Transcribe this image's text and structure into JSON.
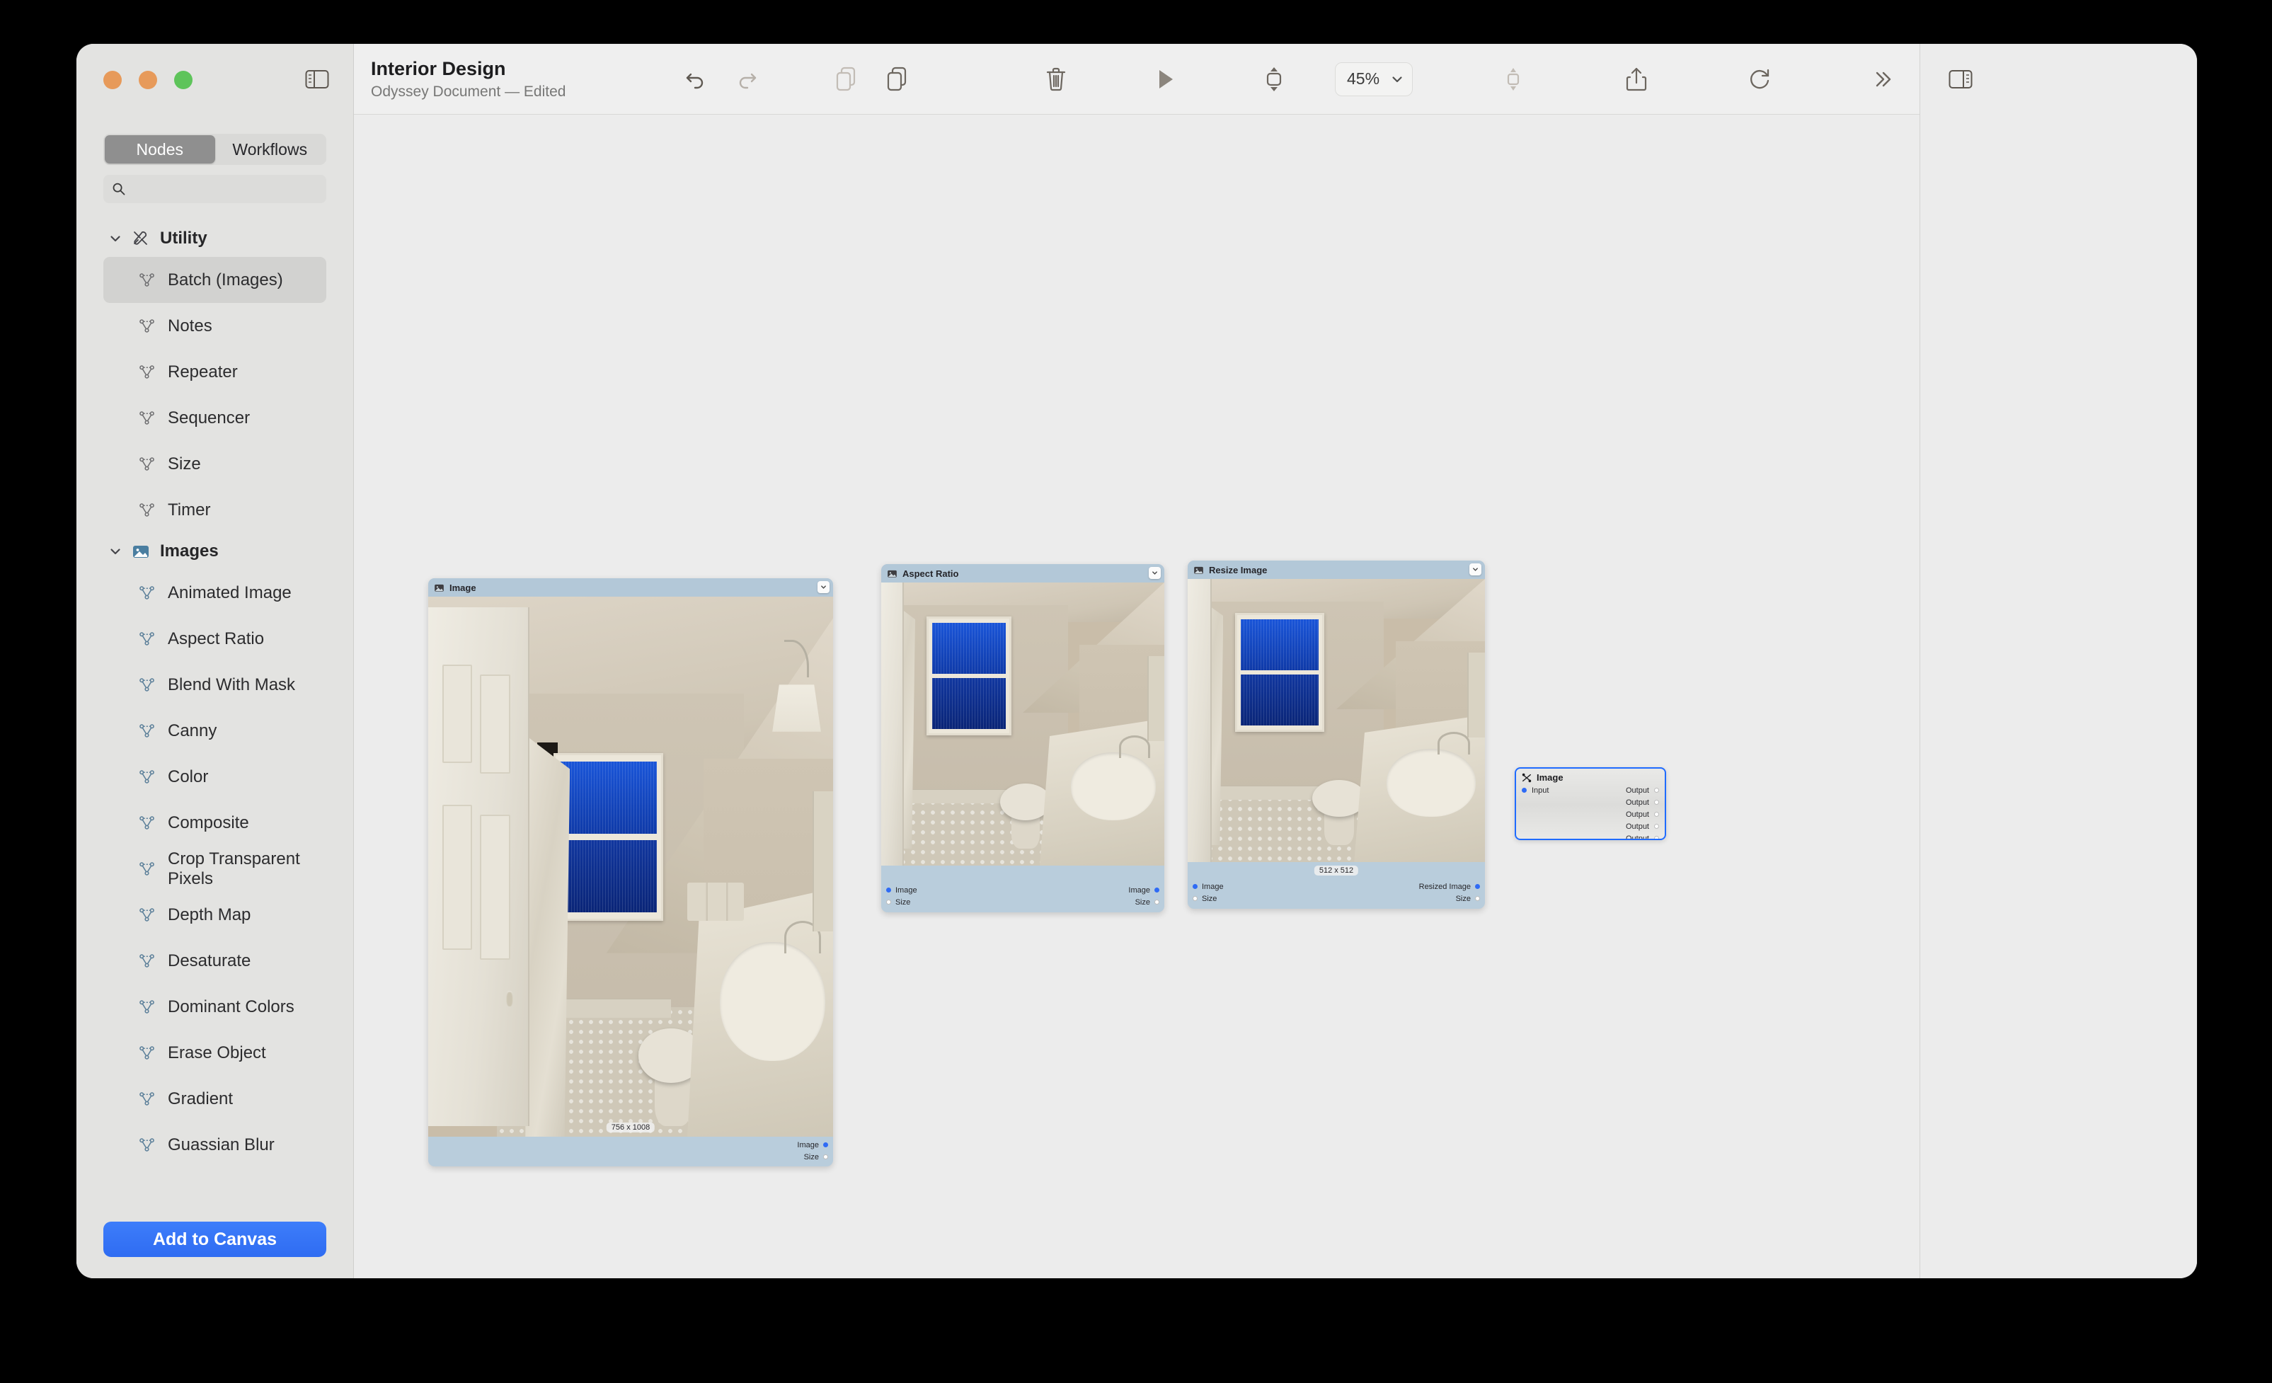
{
  "window": {
    "traffic_lights": [
      "close",
      "minimize",
      "zoom"
    ],
    "sidebar_toggle_icon": "sidebar-left-icon"
  },
  "sidebar": {
    "tabs": [
      {
        "label": "Nodes",
        "active": true
      },
      {
        "label": "Workflows",
        "active": false
      }
    ],
    "search": {
      "placeholder": "",
      "value": "",
      "icon": "search-icon"
    },
    "groups": [
      {
        "label": "Utility",
        "icon": "tools-icon",
        "expanded": true,
        "items": [
          {
            "label": "Batch (Images)",
            "icon": "node-graph-icon",
            "selected": true
          },
          {
            "label": "Notes",
            "icon": "node-graph-icon",
            "selected": false
          },
          {
            "label": "Repeater",
            "icon": "node-graph-icon",
            "selected": false
          },
          {
            "label": "Sequencer",
            "icon": "node-graph-icon",
            "selected": false
          },
          {
            "label": "Size",
            "icon": "node-graph-icon",
            "selected": false
          },
          {
            "label": "Timer",
            "icon": "node-graph-icon",
            "selected": false
          }
        ]
      },
      {
        "label": "Images",
        "icon": "photo-icon",
        "expanded": true,
        "items": [
          {
            "label": "Animated Image",
            "icon": "node-graph-icon",
            "selected": false
          },
          {
            "label": "Aspect Ratio",
            "icon": "node-graph-icon",
            "selected": false
          },
          {
            "label": "Blend With Mask",
            "icon": "node-graph-icon",
            "selected": false
          },
          {
            "label": "Canny",
            "icon": "node-graph-icon",
            "selected": false
          },
          {
            "label": "Color",
            "icon": "node-graph-icon",
            "selected": false
          },
          {
            "label": "Composite",
            "icon": "node-graph-icon",
            "selected": false
          },
          {
            "label": "Crop Transparent Pixels",
            "icon": "node-graph-icon",
            "selected": false
          },
          {
            "label": "Depth Map",
            "icon": "node-graph-icon",
            "selected": false
          },
          {
            "label": "Desaturate",
            "icon": "node-graph-icon",
            "selected": false
          },
          {
            "label": "Dominant Colors",
            "icon": "node-graph-icon",
            "selected": false
          },
          {
            "label": "Erase Object",
            "icon": "node-graph-icon",
            "selected": false
          },
          {
            "label": "Gradient",
            "icon": "node-graph-icon",
            "selected": false
          },
          {
            "label": "Guassian Blur",
            "icon": "node-graph-icon",
            "selected": false
          }
        ]
      }
    ],
    "add_button": "Add to Canvas"
  },
  "toolbar": {
    "title": "Interior Design",
    "subtitle": "Odyssey Document — Edited",
    "buttons": [
      {
        "name": "undo-icon",
        "label": "Undo",
        "enabled": true
      },
      {
        "name": "redo-icon",
        "label": "Redo",
        "enabled": false
      },
      {
        "name": "copy-icon",
        "label": "Copy",
        "enabled": false
      },
      {
        "name": "duplicate-icon",
        "label": "Duplicate",
        "enabled": true
      },
      {
        "name": "trash-icon",
        "label": "Delete",
        "enabled": true
      },
      {
        "name": "play-icon",
        "label": "Run",
        "enabled": true
      },
      {
        "name": "fit-vertical-icon",
        "label": "Fit",
        "enabled": true
      }
    ],
    "zoom": {
      "value": "45%",
      "chevron": "chevron-down-icon"
    },
    "right_buttons": [
      {
        "name": "arrange-icon",
        "label": "Arrange",
        "enabled": false
      },
      {
        "name": "share-icon",
        "label": "Share",
        "enabled": true
      },
      {
        "name": "sync-icon",
        "label": "Sync",
        "enabled": true
      },
      {
        "name": "chevron-double-right-icon",
        "label": "More",
        "enabled": true
      }
    ],
    "right_panel_toggle": "sidebar-right-icon"
  },
  "canvas": {
    "nodes": [
      {
        "id": "image-source",
        "title": "Image",
        "icon": "photo-icon",
        "size_label": "756 x 1008",
        "inputs": [],
        "outputs": [
          {
            "label": "Image",
            "connected": true
          },
          {
            "label": "Size",
            "connected": false
          }
        ],
        "selected": false
      },
      {
        "id": "aspect-ratio",
        "title": "Aspect Ratio",
        "icon": "photo-icon",
        "size_label": "",
        "inputs": [
          {
            "label": "Image",
            "connected": true
          },
          {
            "label": "Size",
            "connected": false
          }
        ],
        "outputs": [
          {
            "label": "Image",
            "connected": true
          },
          {
            "label": "Size",
            "connected": false
          }
        ],
        "selected": false
      },
      {
        "id": "resize-image",
        "title": "Resize Image",
        "icon": "photo-icon",
        "size_label": "512 x 512",
        "inputs": [
          {
            "label": "Image",
            "connected": true
          },
          {
            "label": "Size",
            "connected": false
          }
        ],
        "outputs": [
          {
            "label": "Resized Image",
            "connected": true
          },
          {
            "label": "Size",
            "connected": false
          }
        ],
        "selected": false
      },
      {
        "id": "image-output",
        "title": "Image",
        "icon": "shuffle-icon",
        "size_label": "",
        "inputs": [
          {
            "label": "Input",
            "connected": true
          }
        ],
        "outputs": [
          {
            "label": "Output",
            "connected": false
          },
          {
            "label": "Output",
            "connected": false
          },
          {
            "label": "Output",
            "connected": false
          },
          {
            "label": "Output",
            "connected": false
          },
          {
            "label": "Output",
            "connected": false
          }
        ],
        "selected": true
      }
    ],
    "wire_color": "#1f6bff",
    "accent_color": "#2f6bf5",
    "node_header_color": "#b3c8d8"
  }
}
